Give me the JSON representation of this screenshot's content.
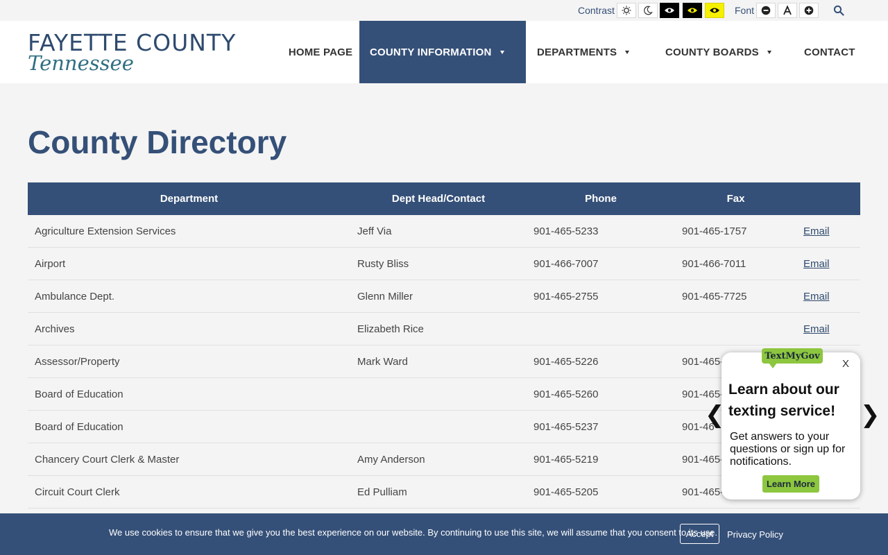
{
  "utility": {
    "contrast_label": "Contrast",
    "font_label": "Font"
  },
  "logo": {
    "line1": "FAYETTE COUNTY",
    "line2": "Tennessee"
  },
  "nav": [
    {
      "label": "HOME PAGE",
      "has_dropdown": false,
      "active": false
    },
    {
      "label": "COUNTY INFORMATION",
      "has_dropdown": true,
      "active": true
    },
    {
      "label": "DEPARTMENTS",
      "has_dropdown": true,
      "active": false
    },
    {
      "label": "COUNTY BOARDS",
      "has_dropdown": true,
      "active": false
    },
    {
      "label": "CONTACT",
      "has_dropdown": false,
      "active": false
    }
  ],
  "page": {
    "title": "County Directory"
  },
  "table": {
    "headers": [
      "Department",
      "Dept Head/Contact",
      "Phone",
      "Fax",
      ""
    ],
    "rows": [
      {
        "department": "Agriculture Extension Services",
        "contact": "Jeff Via",
        "phone": "901-465-5233",
        "fax": "901-465-1757",
        "email": "Email"
      },
      {
        "department": "Airport",
        "contact": "Rusty Bliss",
        "phone": "901-466-7007",
        "fax": "901-466-7011",
        "email": "Email"
      },
      {
        "department": "Ambulance Dept.",
        "contact": "Glenn Miller",
        "phone": "901-465-2755",
        "fax": "901-465-7725",
        "email": "Email"
      },
      {
        "department": "Archives",
        "contact": "Elizabeth Rice",
        "phone": "",
        "fax": "",
        "email": "Email"
      },
      {
        "department": "Assessor/Property",
        "contact": "Mark Ward",
        "phone": "901-465-5226",
        "fax": "901-465-",
        "email": ""
      },
      {
        "department": "Board of Education",
        "contact": "",
        "phone": "901-465-5260",
        "fax": "901-465-",
        "email": ""
      },
      {
        "department": "Board of Education",
        "contact": "",
        "phone": "901-465-5237",
        "fax": "901-46",
        "email": ""
      },
      {
        "department": "Chancery Court Clerk & Master",
        "contact": "Amy Anderson",
        "phone": "901-465-5219",
        "fax": "901-465-",
        "email": ""
      },
      {
        "department": "Circuit Court Clerk",
        "contact": "Ed Pulliam",
        "phone": "901-465-5205",
        "fax": "901-465-",
        "email": ""
      }
    ]
  },
  "cookie": {
    "text": "We use cookies to ensure that we give you the best experience on our website. By continuing to use this site, we will assume that you consent to its use.",
    "accept_label": "Accept",
    "privacy_label": "Privacy Policy"
  },
  "textmygov": {
    "logo": "TextMyGov",
    "close": "X",
    "title": "Learn about our texting service!",
    "body": "Get answers to your questions or sign up for notifications.",
    "button": "Learn More",
    "prev": "❮",
    "next": "❯"
  },
  "colors": {
    "brand_navy": "#355078",
    "teal": "#2f6f82",
    "green": "#8dc63f",
    "yellow": "#f5f000"
  }
}
